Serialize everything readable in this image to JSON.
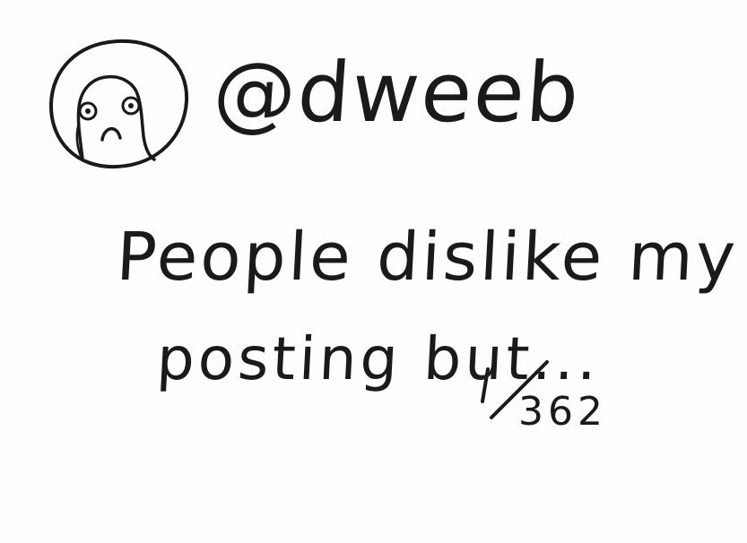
{
  "post": {
    "handle": "@dweeb",
    "text_line_1": "People dislike my",
    "text_line_2": "posting but...",
    "thread_index": "1",
    "thread_total": "362"
  },
  "avatar": {
    "icon": "sad-face-icon",
    "description_color": "#1a1a1a"
  }
}
